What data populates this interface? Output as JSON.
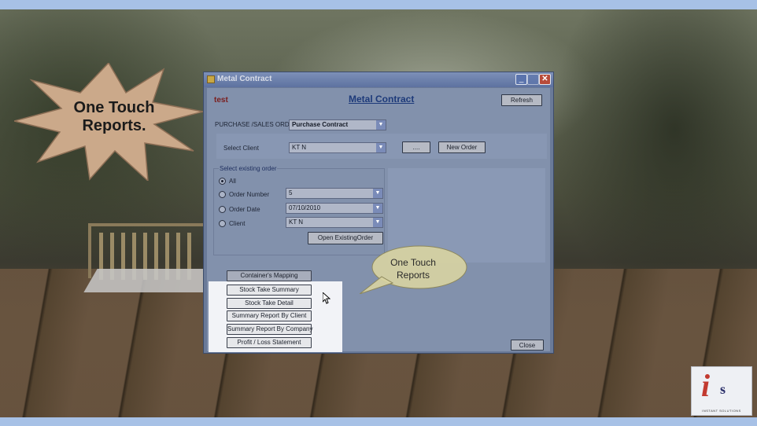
{
  "starburst": {
    "text_line1": "One Touch",
    "text_line2": "Reports."
  },
  "window": {
    "title": "Metal Contract",
    "test_label": "test",
    "form_title": "Metal Contract",
    "refresh_label": "Refresh",
    "order_type_label": "PURCHASE /SALES ORDER",
    "order_type_value": "Purchase Contract",
    "select_client_label": "Select Client",
    "select_client_value": "KT N",
    "ellipsis_label": "....",
    "new_order_label": "New Order",
    "existing_group_label": "Select existing order",
    "radio_all_label": "All",
    "radio_order_number_label": "Order Number",
    "order_number_value": "5",
    "radio_order_date_label": "Order Date",
    "order_date_value": "07/10/2010",
    "radio_client_label": "Client",
    "client_value": "KT N",
    "open_order_label": "Open ExistingOrder",
    "selected_radio": "All",
    "reports": [
      "Container's Mapping",
      "Stock Take Summary",
      "Stock Take Detail",
      "Summary Report By Client",
      "Summary Report By Company",
      "Profit / Loss Statement"
    ],
    "close_label": "Close",
    "minimize_glyph": "_",
    "close_glyph": "✕"
  },
  "callout": {
    "text_line1": "One Touch",
    "text_line2": "Reports"
  },
  "logo": {
    "mark": "i",
    "mark_s": "s",
    "caption": "INSTANT SOLUTIONS"
  },
  "colors": {
    "accent_strip": "#a7c1e6",
    "title_text": "#1d3a7a",
    "test_text": "#7a1e1e",
    "logo_red": "#c23a30"
  },
  "icons": [
    "app-icon",
    "minimize-icon",
    "maximize-icon",
    "close-icon",
    "dropdown-arrow-icon",
    "mouse-cursor-icon"
  ]
}
